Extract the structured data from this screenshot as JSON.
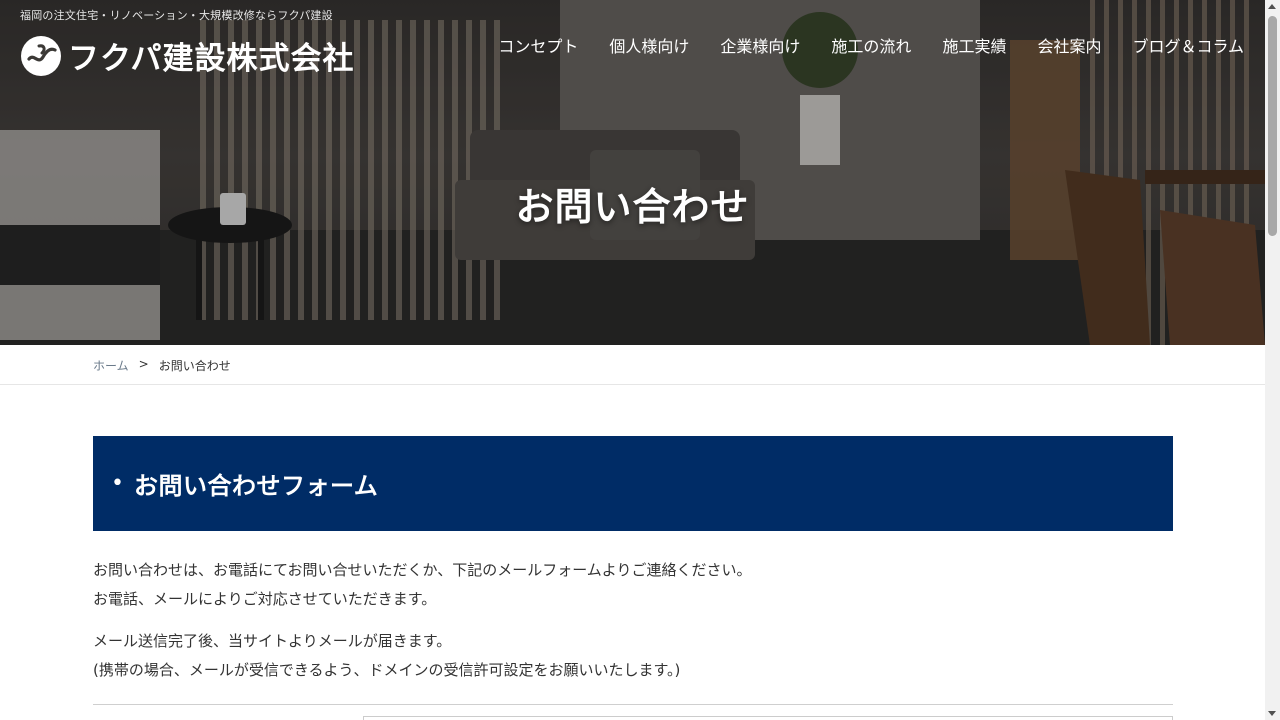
{
  "site": {
    "tagline": "福岡の注文住宅・リノベーション・大規模改修ならフクパ建設",
    "logo_text": "フクパ建設株式会社",
    "logo_icon": "fukupa-logo-mark"
  },
  "nav": {
    "items": [
      {
        "label": "コンセプト"
      },
      {
        "label": "個人様向け"
      },
      {
        "label": "企業様向け"
      },
      {
        "label": "施工の流れ"
      },
      {
        "label": "施工実績"
      },
      {
        "label": "会社案内"
      },
      {
        "label": "ブログ＆コラム"
      }
    ]
  },
  "hero": {
    "title": "お問い合わせ"
  },
  "breadcrumb": {
    "home": "ホーム",
    "separator": ">",
    "current": "お問い合わせ"
  },
  "form_section": {
    "bullet": "•",
    "heading": "お問い合わせフォーム",
    "intro_line1": "お問い合わせは、お電話にてお問い合せいただくか、下記のメールフォームよりご連絡ください。",
    "intro_line2": "お電話、メールによりご対応させていただきます。",
    "notice_line1": "メール送信完了後、当サイトよりメールが届きます。",
    "notice_line2": "(携帯の場合、メールが受信できるよう、ドメインの受信許可設定をお願いいたします。)"
  },
  "colors": {
    "header_bg": "#002c66",
    "text": "#333333",
    "breadcrumb_link": "#6a7a8a",
    "nav_text": "#ffffff"
  }
}
